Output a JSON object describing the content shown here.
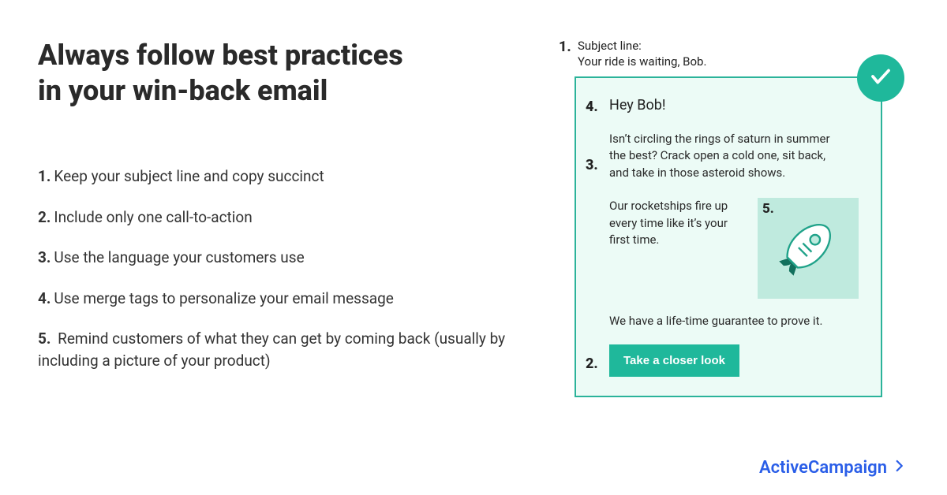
{
  "heading_line1": "Always follow best practices",
  "heading_line2": "in your win-back email",
  "tips": [
    "Keep your subject line and copy succinct",
    "Include only one call-to-action",
    "Use the language your customers use",
    "Use merge tags to personalize your email message",
    " Remind customers of what they can get by coming back (usually by including a picture of your product)"
  ],
  "example": {
    "subject_label": "Subject line:",
    "subject_text": "Your ride is waiting, Bob.",
    "greeting": "Hey Bob!",
    "para1": "Isn’t circling the rings of saturn in summer the best? Crack open a cold one, sit back, and take in those asteroid shows.",
    "para2": "Our rocketships fire up every time like it’s your first time.",
    "para3": "We have a life-time guarantee to prove it.",
    "cta": "Take a closer look"
  },
  "callouts": {
    "c1": "1.",
    "c2": "2.",
    "c3": "3.",
    "c4": "4.",
    "c5": "5."
  },
  "brand": {
    "name": "ActiveCampaign"
  },
  "colors": {
    "accent": "#1fb89b",
    "accent_border": "#2bb39a",
    "card_bg": "#ecfbf6",
    "brand_blue": "#2a5ee8"
  }
}
